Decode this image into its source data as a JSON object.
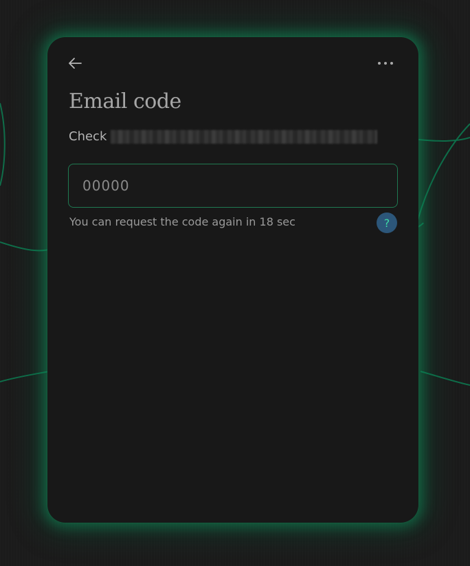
{
  "colors": {
    "background": "#1b1b1b",
    "card": "#181818",
    "accent_green": "#1f7a52",
    "help_bg": "#2c5679",
    "help_fg": "#3fd9a6"
  },
  "header": {
    "back_icon": "arrow-left-icon",
    "more_icon": "more-horizontal-icon"
  },
  "title": "Email code",
  "check": {
    "label": "Check"
  },
  "code_input": {
    "placeholder": "00000",
    "value": ""
  },
  "resend": {
    "text": "You can request the code again in 18 sec"
  },
  "help": {
    "label": "?",
    "icon": "question-icon"
  }
}
